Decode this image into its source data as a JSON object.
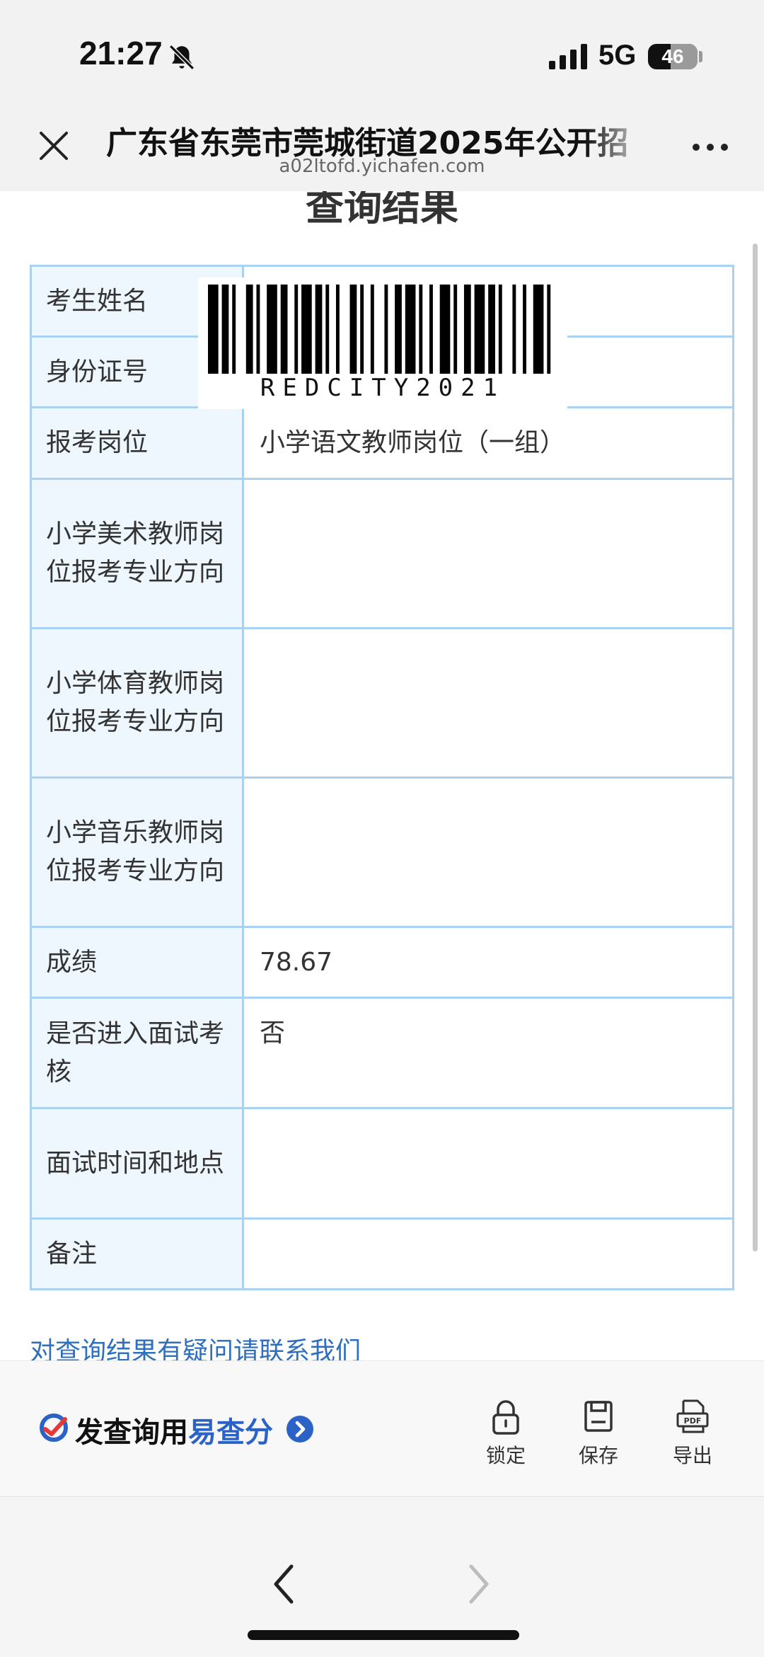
{
  "status_bar": {
    "time": "21:27",
    "network": "5G",
    "battery": "46",
    "icons": [
      "bell-muted-icon",
      "signal-icon",
      "battery-icon"
    ]
  },
  "browser": {
    "title": "广东省东莞市莞城街道2025年公开招",
    "url": "a02ltofd.yichafen.com",
    "icons": [
      "close-icon",
      "more-icon"
    ]
  },
  "page": {
    "heading": "查询结果",
    "barcode_text": "REDCITY2021"
  },
  "result_table": {
    "rows": [
      {
        "label": "考生姓名",
        "value": ""
      },
      {
        "label": "身份证号",
        "value": ""
      },
      {
        "label": "报考岗位",
        "value": "小学语文教师岗位（一组）"
      },
      {
        "label": "小学美术教师岗位报考专业方向",
        "value": ""
      },
      {
        "label": "小学体育教师岗位报考专业方向",
        "value": ""
      },
      {
        "label": "小学音乐教师岗位报考专业方向",
        "value": ""
      },
      {
        "label": "成绩",
        "value": "78.67"
      },
      {
        "label": "是否进入面试考核",
        "value": "否"
      },
      {
        "label": "面试时间和地点",
        "value": ""
      },
      {
        "label": "备注",
        "value": ""
      }
    ]
  },
  "contact_link": "对查询结果有疑问请联系我们",
  "action_bar": {
    "brand_prefix": "发查询用",
    "brand_accent": "易查分",
    "buttons": [
      {
        "label": "锁定",
        "icon": "lock-icon"
      },
      {
        "label": "保存",
        "icon": "save-icon"
      },
      {
        "label": "导出",
        "icon": "pdf-icon"
      }
    ]
  },
  "nav": {
    "icons": [
      "chevron-left-icon",
      "chevron-right-icon"
    ]
  },
  "colors": {
    "table_border": "#a9d1f2",
    "label_bg": "#eef6fe",
    "link": "#2f6fbf",
    "brand_accent": "#2b62c6"
  }
}
